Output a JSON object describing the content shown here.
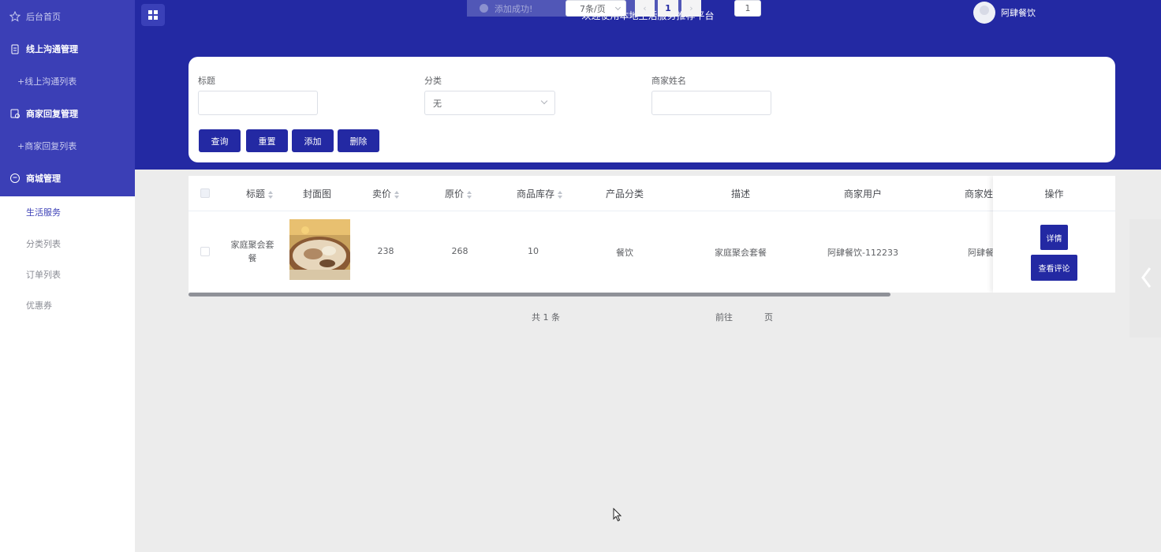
{
  "sidebar": {
    "home": "后台首页",
    "groups": [
      {
        "title": "线上沟通管理",
        "sub": "+线上沟通列表"
      },
      {
        "title": "商家回复管理",
        "sub": "+商家回复列表"
      },
      {
        "title": "商城管理"
      }
    ],
    "mall_items": [
      "生活服务",
      "分类列表",
      "订单列表",
      "优惠券"
    ]
  },
  "header": {
    "title": "欢迎使用本地生活服务推荐平台",
    "toast": "添加成功!",
    "username": "阿肆餐饮"
  },
  "search": {
    "title_label": "标题",
    "title_value": "",
    "category_label": "分类",
    "category_value": "无",
    "merchant_label": "商家姓名",
    "merchant_value": "",
    "buttons": {
      "query": "查询",
      "reset": "重置",
      "add": "添加",
      "delete": "删除"
    }
  },
  "table": {
    "columns": [
      "标题",
      "封面图",
      "卖价",
      "原价",
      "商品库存",
      "产品分类",
      "描述",
      "商家用户",
      "商家姓",
      "操作"
    ],
    "rows": [
      {
        "title": "家庭聚会套餐",
        "sell_price": "238",
        "original_price": "268",
        "stock": "10",
        "category": "餐饮",
        "description": "家庭聚会套餐",
        "merchant_user": "阿肆餐饮-112233",
        "merchant_name": "阿肆餐",
        "actions": {
          "detail": "详情",
          "comments": "查看评论"
        }
      }
    ]
  },
  "pagination": {
    "total": "共 1 条",
    "page_size": "7条/页",
    "current_page": "1",
    "goto_label": "前往",
    "goto_value": "1",
    "page_suffix": "页"
  },
  "colors": {
    "primary": "#2329a3",
    "sidebar": "#3b3fb6",
    "active_text": "#3b3fb6"
  }
}
